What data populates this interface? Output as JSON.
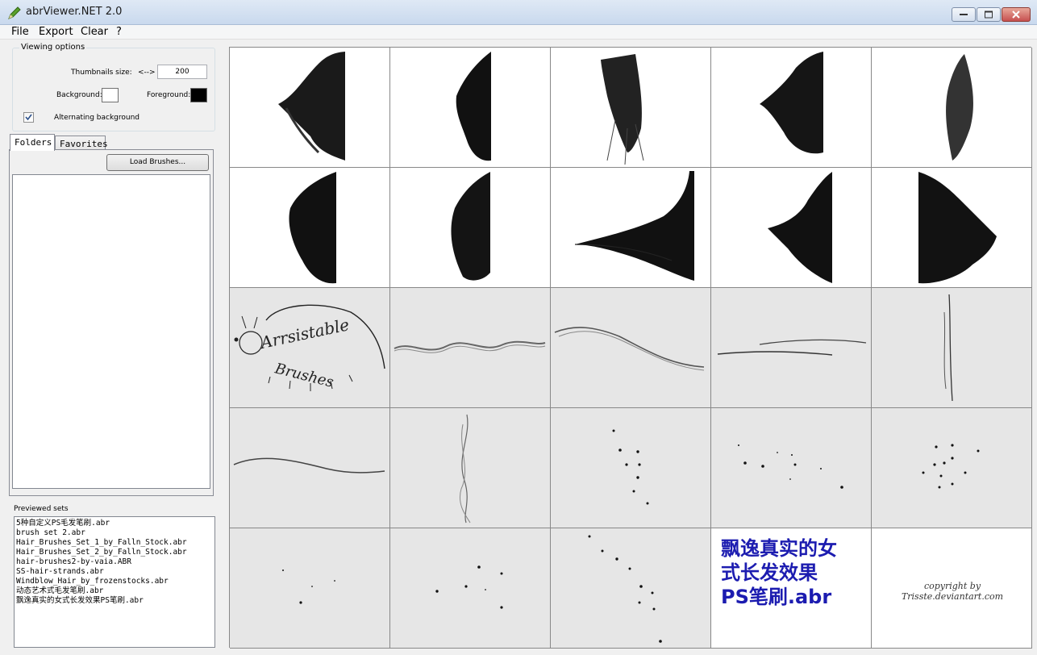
{
  "window": {
    "title": "abrViewer.NET 2.0"
  },
  "menu": [
    "File",
    "Export",
    "Clear",
    "?"
  ],
  "viewing_options": {
    "legend": "Viewing options",
    "thumb_label": "Thumbnails size:",
    "thumb_arrows": "<-->",
    "thumb_value": "200",
    "background_label": "Background:",
    "foreground_label": "Foreground:",
    "background_color": "#ffffff",
    "foreground_color": "#000000",
    "alternating_label": "Alternating background",
    "alternating_checked": true
  },
  "tabs": {
    "folders": "Folders",
    "favorites": "Favorites"
  },
  "load_button": "Load Brushes...",
  "previewed": {
    "label": "Previewed sets",
    "items": [
      "5种自定义PS毛发笔刷.abr",
      "brush set 2.abr",
      "Hair_Brushes_Set_1_by_Falln_Stock.abr",
      "Hair_Brushes_Set_2_by_Falln_Stock.abr",
      "hair-brushes2-by-vaia.ABR",
      "SS-hair-strands.abr",
      "Windblow_Hair_by_frozenstocks.abr",
      "动态艺术式毛发笔刷.abr",
      "飘逸真实的女式长发效果PS笔刷.abr"
    ]
  },
  "thumbnails": {
    "cn_text": "飘逸真实的女\n式长发效果\nPS笔刷.abr",
    "copyright": "copyright by Trisste.deviantart.com",
    "arrsistable": "Arrsistable Brushes"
  }
}
